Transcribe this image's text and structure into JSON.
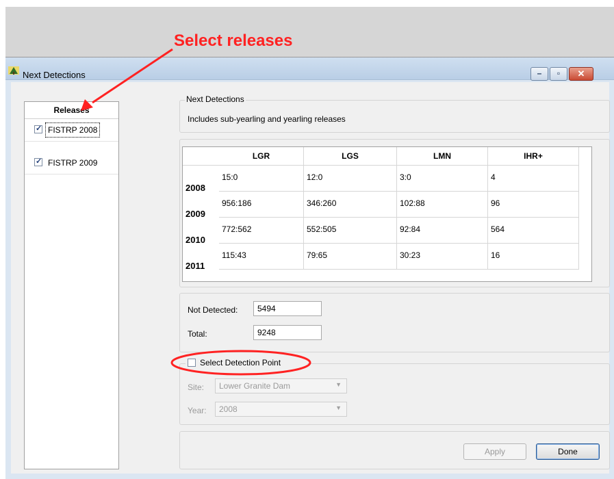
{
  "annotations": {
    "select_releases": "Select releases"
  },
  "window": {
    "title": "Next Detections",
    "app_icon": "tree-icon",
    "controls": {
      "minimize": "–",
      "maximize": "▫",
      "close": "✕"
    }
  },
  "releases": {
    "header": "Releases",
    "items": [
      {
        "label": "FISTRP 2008",
        "checked": true
      },
      {
        "label": "FISTRP 2009",
        "checked": true
      }
    ]
  },
  "next_detections": {
    "group_title": "Next Detections",
    "description": "Includes sub-yearling and yearling releases"
  },
  "detections_table": {
    "columns": [
      "LGR",
      "LGS",
      "LMN",
      "IHR+"
    ],
    "rows": [
      {
        "year": "2008",
        "values": [
          "15:0",
          "12:0",
          "3:0",
          "4"
        ]
      },
      {
        "year": "2009",
        "values": [
          "956:186",
          "346:260",
          "102:88",
          "96"
        ]
      },
      {
        "year": "2010",
        "values": [
          "772:562",
          "552:505",
          "92:84",
          "564"
        ]
      },
      {
        "year": "2011",
        "values": [
          "115:43",
          "79:65",
          "30:23",
          "16"
        ]
      }
    ]
  },
  "summary": {
    "not_detected_label": "Not Detected:",
    "not_detected_value": "5494",
    "total_label": "Total:",
    "total_value": "9248"
  },
  "detection_point": {
    "checkbox_label": "Select Detection Point",
    "checked": false,
    "site_label": "Site:",
    "site_value": "Lower Granite Dam",
    "year_label": "Year:",
    "year_value": "2008"
  },
  "buttons": {
    "apply": "Apply",
    "done": "Done"
  },
  "colors": {
    "annotation_red": "#ff2222",
    "title_bar": "#c6d8ee",
    "close_button": "#c94a34"
  }
}
